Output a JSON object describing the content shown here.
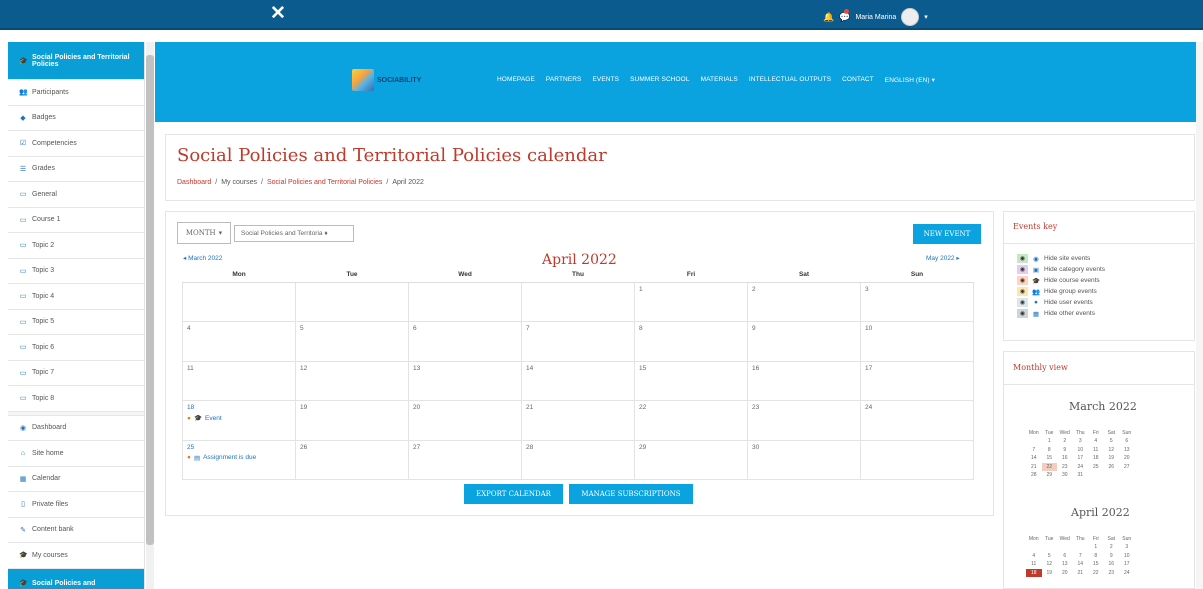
{
  "topbar": {
    "close_glyph": "✕",
    "user_name": "Maria Marina",
    "dropdown_glyph": "▾"
  },
  "sidebar": {
    "items": [
      {
        "label": "Social Policies and Territorial Policies",
        "icon": "graduation-cap-icon",
        "glyph": "🎓",
        "active": true
      },
      {
        "label": "Participants",
        "icon": "users-icon",
        "glyph": "👥"
      },
      {
        "label": "Badges",
        "icon": "shield-icon",
        "glyph": "◆"
      },
      {
        "label": "Competencies",
        "icon": "check-square-icon",
        "glyph": "☑"
      },
      {
        "label": "Grades",
        "icon": "table-icon",
        "glyph": "☰"
      },
      {
        "label": "General",
        "icon": "folder-icon",
        "glyph": "▭"
      },
      {
        "label": "Course 1",
        "icon": "folder-icon",
        "glyph": "▭"
      },
      {
        "label": "Topic 2",
        "icon": "folder-icon",
        "glyph": "▭"
      },
      {
        "label": "Topic 3",
        "icon": "folder-icon",
        "glyph": "▭"
      },
      {
        "label": "Topic 4",
        "icon": "folder-icon",
        "glyph": "▭"
      },
      {
        "label": "Topic 5",
        "icon": "folder-icon",
        "glyph": "▭"
      },
      {
        "label": "Topic 6",
        "icon": "folder-icon",
        "glyph": "▭"
      },
      {
        "label": "Topic 7",
        "icon": "folder-icon",
        "glyph": "▭"
      },
      {
        "label": "Topic 8",
        "icon": "folder-icon",
        "glyph": "▭"
      },
      {
        "label": "Dashboard",
        "icon": "dashboard-icon",
        "glyph": "◉"
      },
      {
        "label": "Site home",
        "icon": "home-icon",
        "glyph": "⌂"
      },
      {
        "label": "Calendar",
        "icon": "calendar-icon",
        "glyph": "▦"
      },
      {
        "label": "Private files",
        "icon": "file-icon",
        "glyph": "▯"
      },
      {
        "label": "Content bank",
        "icon": "pencil-icon",
        "glyph": "✎"
      },
      {
        "label": "My courses",
        "icon": "graduation-cap-icon",
        "glyph": "🎓"
      },
      {
        "label": "Social Policies and",
        "icon": "graduation-cap-icon",
        "glyph": "🎓",
        "active": true
      }
    ]
  },
  "header": {
    "logo_text": "SOCIABILITY",
    "nav": [
      "HOMEPAGE",
      "PARTNERS",
      "EVENTS",
      "SUMMER SCHOOL",
      "MATERIALS",
      "INTELLECTUAL OUTPUTS",
      "CONTACT",
      "ENGLISH (EN) ▾"
    ]
  },
  "page": {
    "title": "Social Policies and Territorial Policies calendar",
    "breadcrumb": [
      "Dashboard",
      "My courses",
      "Social Policies and Territorial Policies",
      "April 2022"
    ]
  },
  "calendar": {
    "view_select": "MONTH",
    "course_select": "Social Policies and Territoria ♦",
    "new_event": "NEW EVENT",
    "prev": "◂ March 2022",
    "next": "May 2022 ▸",
    "month_title": "April 2022",
    "weekdays": [
      "Mon",
      "Tue",
      "Wed",
      "Thu",
      "Fri",
      "Sat",
      "Sun"
    ],
    "weeks": [
      [
        "",
        "",
        "",
        "",
        "1",
        "2",
        "3"
      ],
      [
        "4",
        "5",
        "6",
        "7",
        "8",
        "9",
        "10"
      ],
      [
        "11",
        "12",
        "13",
        "14",
        "15",
        "16",
        "17"
      ],
      [
        "18",
        "19",
        "20",
        "21",
        "22",
        "23",
        "24"
      ],
      [
        "25",
        "26",
        "27",
        "28",
        "29",
        "30",
        ""
      ]
    ],
    "events": {
      "18": {
        "label": "Event",
        "icon": "graduation-cap-icon"
      },
      "25": {
        "label": "Assignment is due",
        "icon": "assignment-icon"
      }
    },
    "export": "EXPORT CALENDAR",
    "manage": "MANAGE SUBSCRIPTIONS"
  },
  "events_key": {
    "title": "Events key",
    "items": [
      {
        "label": "Hide site events",
        "color": "#c5e8c5",
        "icon": "globe-icon",
        "glyph": "◉"
      },
      {
        "label": "Hide category events",
        "color": "#e2cdf1",
        "icon": "cubes-icon",
        "glyph": "▣"
      },
      {
        "label": "Hide course events",
        "color": "#ffd3bd",
        "icon": "graduation-cap-icon",
        "glyph": "🎓"
      },
      {
        "label": "Hide group events",
        "color": "#fee7ae",
        "icon": "users-icon",
        "glyph": "👥"
      },
      {
        "label": "Hide user events",
        "color": "#dce7ec",
        "icon": "user-icon",
        "glyph": "●"
      },
      {
        "label": "Hide other events",
        "color": "#ced4da",
        "icon": "calendar-icon",
        "glyph": "▦"
      }
    ]
  },
  "monthly_view": {
    "title": "Monthly view",
    "months": [
      {
        "name": "March 2022",
        "weekdays": [
          "Mon",
          "Tue",
          "Wed",
          "Thu",
          "Fri",
          "Sat",
          "Sun"
        ],
        "weeks": [
          [
            "",
            "1",
            "2",
            "3",
            "4",
            "5",
            "6"
          ],
          [
            "7",
            "8",
            "9",
            "10",
            "11",
            "12",
            "13"
          ],
          [
            "14",
            "15",
            "16",
            "17",
            "18",
            "19",
            "20"
          ],
          [
            "21",
            "22",
            "23",
            "24",
            "25",
            "26",
            "27"
          ],
          [
            "28",
            "29",
            "30",
            "31",
            "",
            "",
            ""
          ]
        ],
        "highlight": "22"
      },
      {
        "name": "April 2022",
        "weekdays": [
          "Mon",
          "Tue",
          "Wed",
          "Thu",
          "Fri",
          "Sat",
          "Sun"
        ],
        "weeks": [
          [
            "",
            "",
            "",
            "",
            "1",
            "2",
            "3"
          ],
          [
            "4",
            "5",
            "6",
            "7",
            "8",
            "9",
            "10"
          ],
          [
            "11",
            "12",
            "13",
            "14",
            "15",
            "16",
            "17"
          ],
          [
            "18",
            "19",
            "20",
            "21",
            "22",
            "23",
            "24"
          ]
        ],
        "today": "18"
      }
    ]
  }
}
